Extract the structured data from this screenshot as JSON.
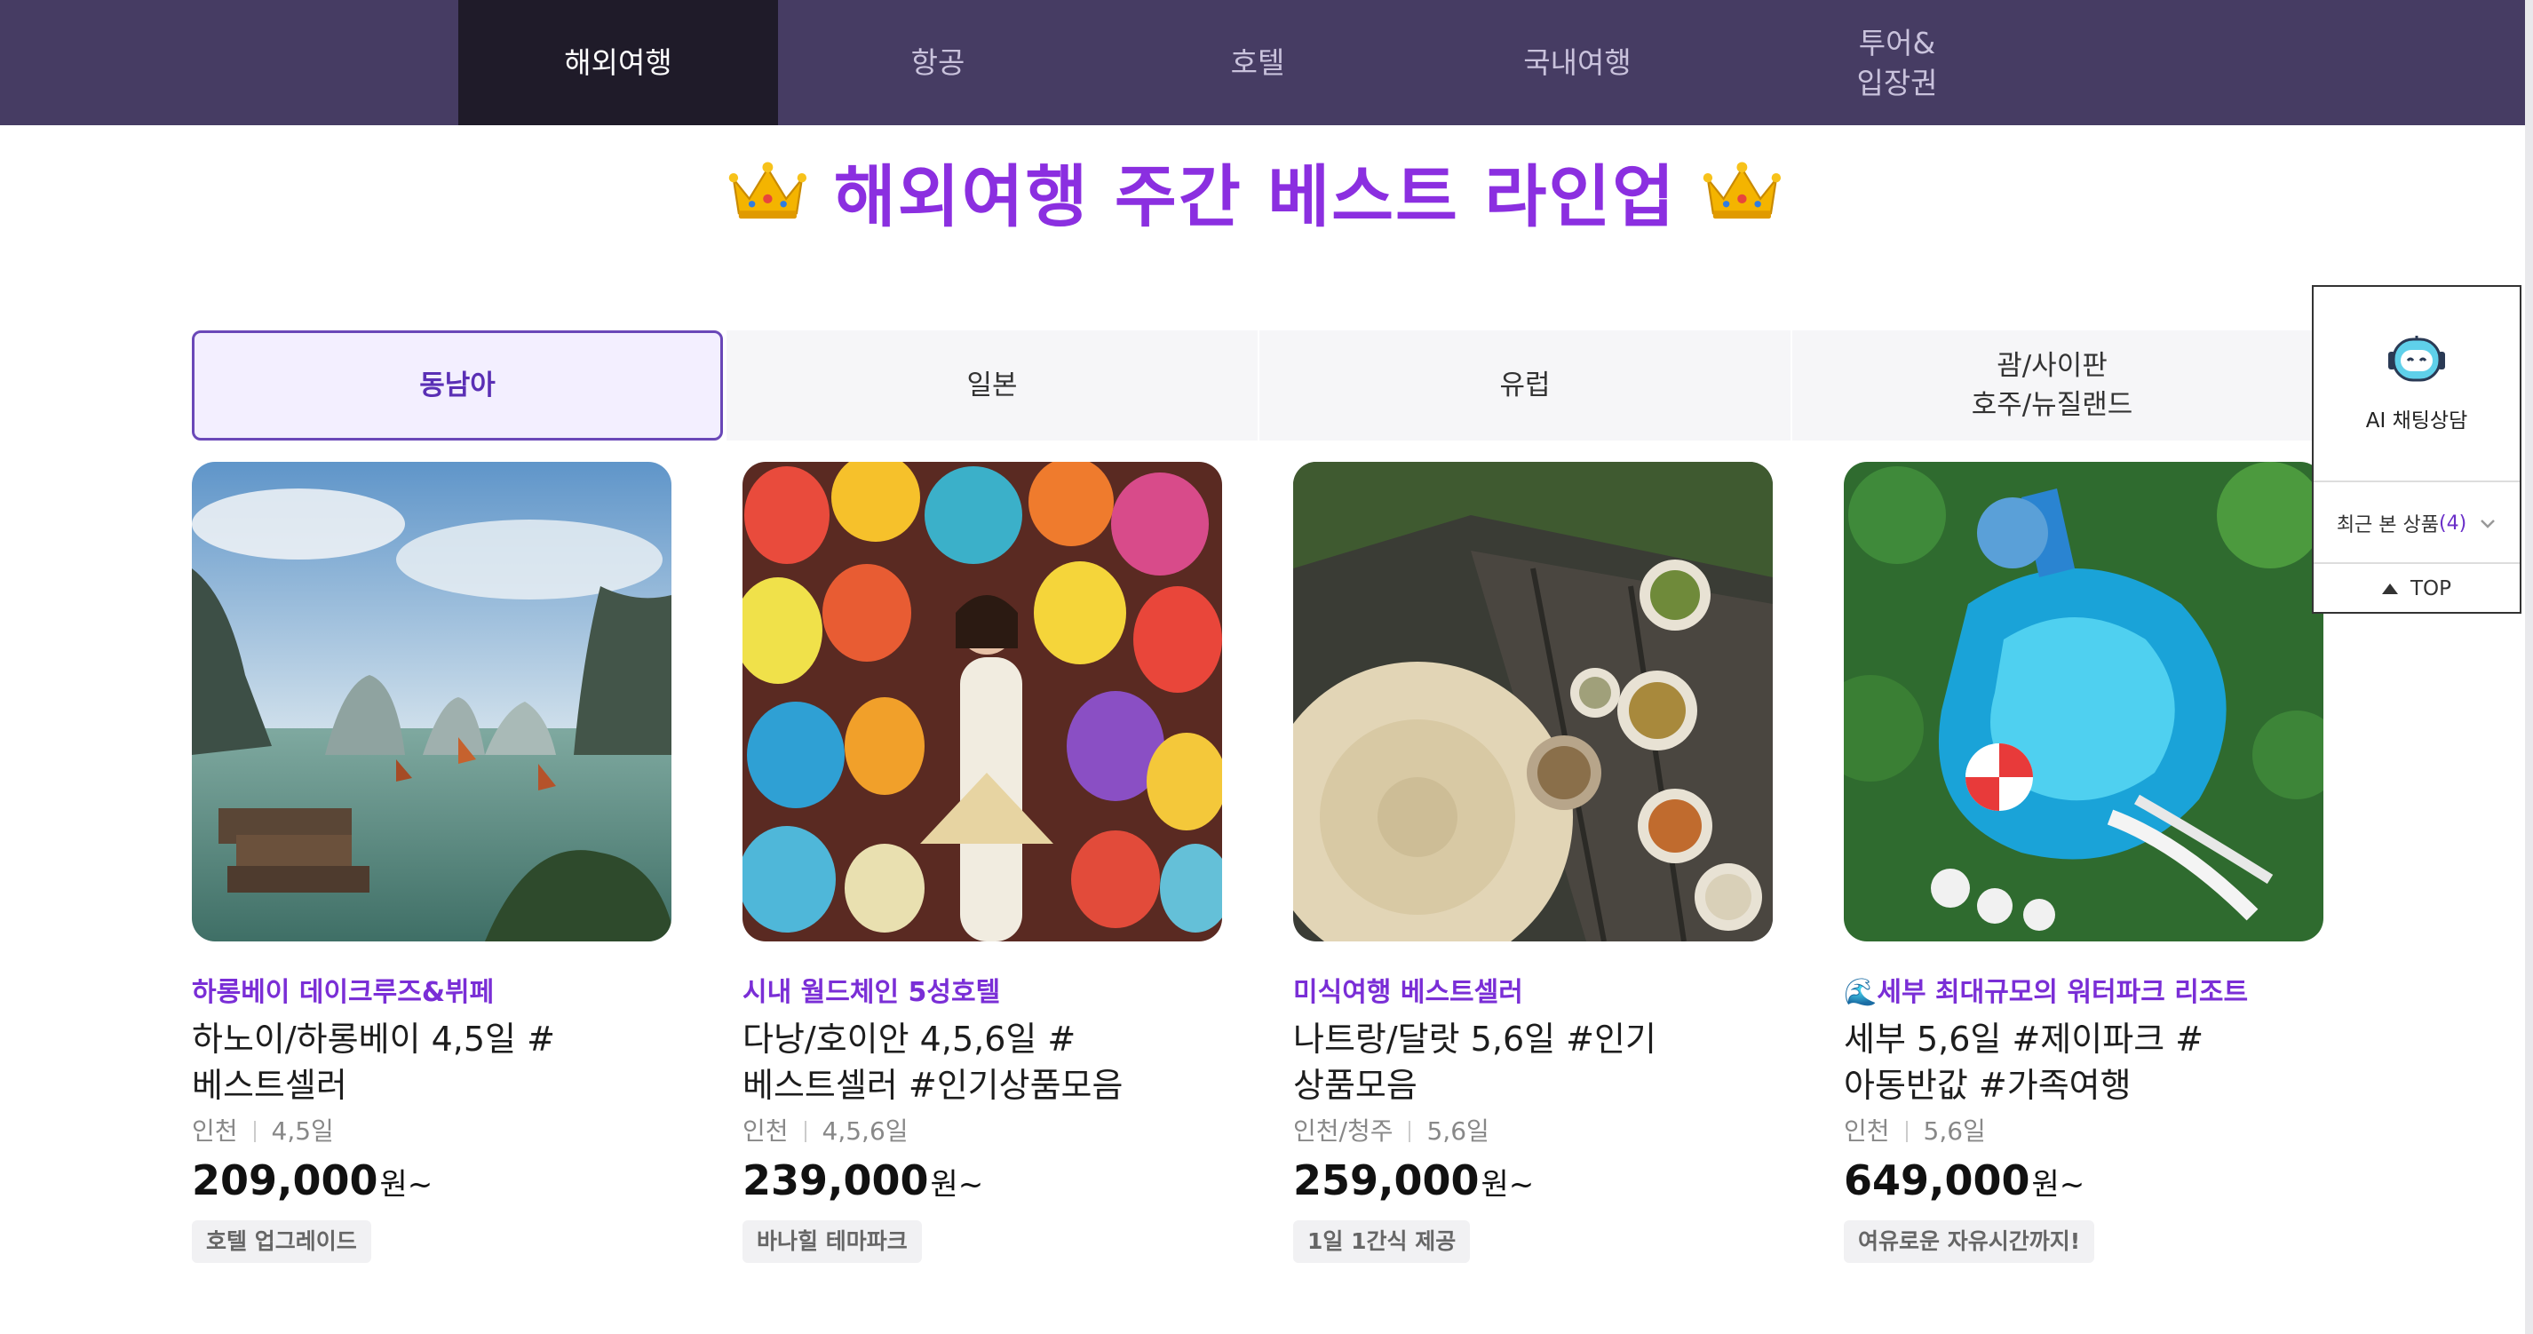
{
  "nav": {
    "items": [
      {
        "label": "해외여행",
        "active": true
      },
      {
        "label": "항공"
      },
      {
        "label": "호텔"
      },
      {
        "label": "국내여행"
      },
      {
        "label": "투어&\n입장권"
      }
    ]
  },
  "heading": {
    "title": "해외여행 주간 베스트 라인업",
    "icon": "crown-icon",
    "color": "#8b2fe0"
  },
  "regions": {
    "tabs": [
      {
        "label": "동남아",
        "active": true
      },
      {
        "label": "일본"
      },
      {
        "label": "유럽"
      },
      {
        "label": "괌/사이판\n호주/뉴질랜드"
      }
    ]
  },
  "products": [
    {
      "subtitle": "하롱베이 데이크루즈&뷔페",
      "title": "하노이/하롱베이 4,5일 #베스트셀러",
      "departure": "인천",
      "duration": "4,5일",
      "price": "209,000",
      "price_unit": "원~",
      "tag": "호텔 업그레이드"
    },
    {
      "subtitle": "시내 월드체인 5성호텔",
      "title": "다낭/호이안 4,5,6일 #베스트셀러 #인기상품모음",
      "departure": "인천",
      "duration": "4,5,6일",
      "price": "239,000",
      "price_unit": "원~",
      "tag": "바나힐 테마파크"
    },
    {
      "subtitle": "미식여행 베스트셀러",
      "title": "나트랑/달랏 5,6일 #인기 상품모음",
      "departure": "인천/청주",
      "duration": "5,6일",
      "price": "259,000",
      "price_unit": "원~",
      "tag": "1일 1간식 제공"
    },
    {
      "subtitle": "🌊세부 최대규모의 워터파크 리조트",
      "title": "세부 5,6일 #제이파크 #아동반값 #가족여행",
      "departure": "인천",
      "duration": "5,6일",
      "price": "649,000",
      "price_unit": "원~",
      "tag": "여유로운 자유시간까지!"
    }
  ],
  "widget": {
    "ai_label": "AI 채팅상담",
    "recent_label": "최근 본 상품",
    "recent_count": "(4)",
    "top_label": "TOP"
  },
  "colors": {
    "nav_bg": "#463c63",
    "nav_active": "#1f1b29",
    "accent": "#7a2ed6"
  }
}
